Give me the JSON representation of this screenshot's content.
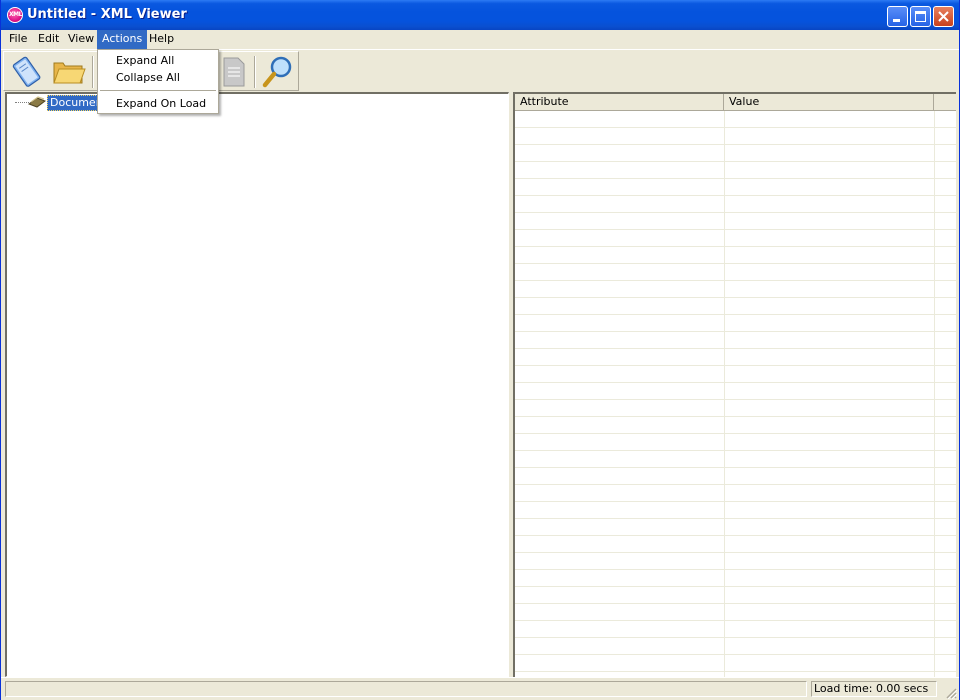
{
  "window": {
    "title": "Untitled - XML Viewer",
    "app_icon_text": "XML"
  },
  "menubar": {
    "items": [
      {
        "label": "File"
      },
      {
        "label": "Edit"
      },
      {
        "label": "View"
      },
      {
        "label": "Actions",
        "active": true
      },
      {
        "label": "Help"
      }
    ]
  },
  "actions_menu": {
    "items": [
      {
        "label": "Expand All"
      },
      {
        "label": "Collapse All"
      },
      {
        "label": "Expand On Load"
      }
    ]
  },
  "toolbar": {
    "buttons": [
      {
        "icon": "new-document-icon"
      },
      {
        "icon": "open-folder-icon"
      },
      {
        "icon": "page-icon"
      },
      {
        "icon": "magnifier-icon"
      }
    ]
  },
  "tree": {
    "root_label": "Document"
  },
  "grid": {
    "columns": [
      "Attribute",
      "Value"
    ]
  },
  "status": {
    "load_time": "Load time: 0.00 secs"
  },
  "colors": {
    "titlebar": "#0553dd",
    "selection": "#316ac5",
    "face": "#ece9d8"
  }
}
